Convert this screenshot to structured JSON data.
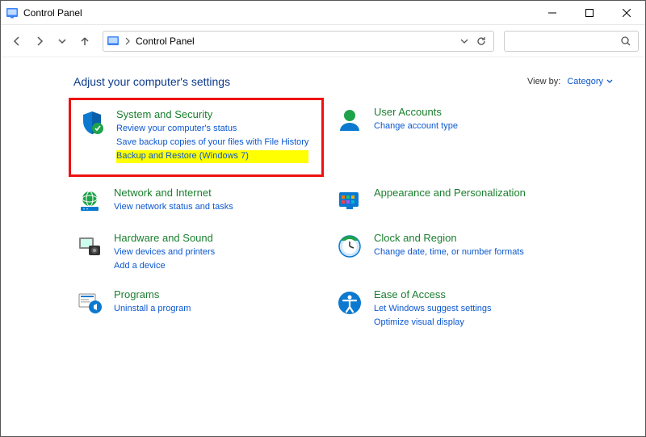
{
  "window": {
    "title": "Control Panel"
  },
  "address": {
    "path": "Control Panel"
  },
  "header": {
    "heading": "Adjust your computer's settings",
    "viewby_label": "View by:",
    "viewby_value": "Category"
  },
  "left": [
    {
      "title": "System and Security",
      "links": [
        "Review your computer's status",
        "Save backup copies of your files with File History",
        "Backup and Restore (Windows 7)"
      ],
      "highlighted": true,
      "yellow_index": 2,
      "icon": "shield"
    },
    {
      "title": "Network and Internet",
      "links": [
        "View network status and tasks"
      ],
      "icon": "network"
    },
    {
      "title": "Hardware and Sound",
      "links": [
        "View devices and printers",
        "Add a device"
      ],
      "icon": "hardware"
    },
    {
      "title": "Programs",
      "links": [
        "Uninstall a program"
      ],
      "icon": "programs"
    }
  ],
  "right": [
    {
      "title": "User Accounts",
      "links": [
        "Change account type"
      ],
      "icon": "user"
    },
    {
      "title": "Appearance and Personalization",
      "links": [],
      "icon": "appearance"
    },
    {
      "title": "Clock and Region",
      "links": [
        "Change date, time, or number formats"
      ],
      "icon": "clock"
    },
    {
      "title": "Ease of Access",
      "links": [
        "Let Windows suggest settings",
        "Optimize visual display"
      ],
      "icon": "ease"
    }
  ]
}
